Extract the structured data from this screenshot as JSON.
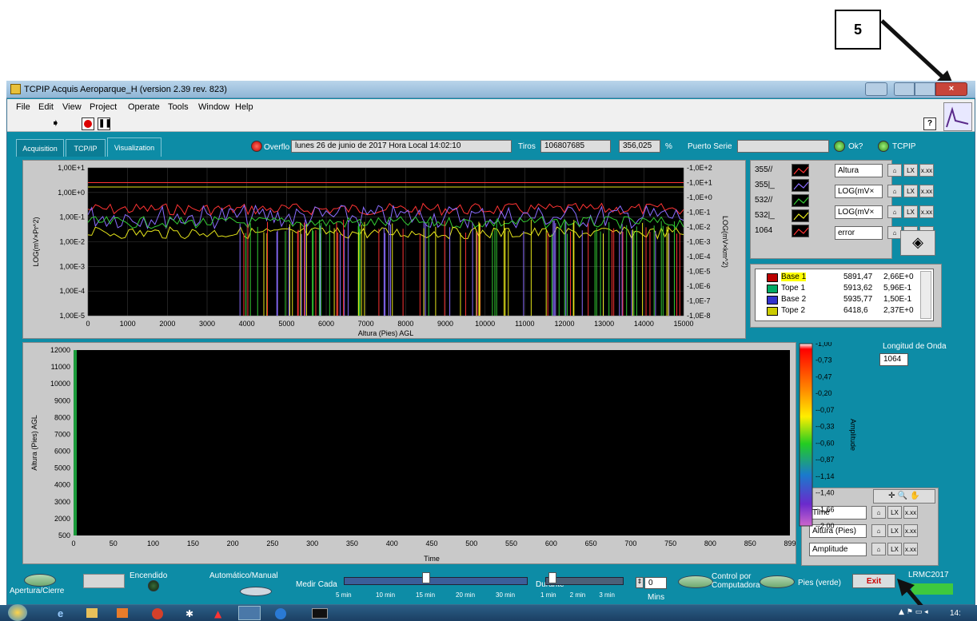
{
  "annotation": {
    "number": "5"
  },
  "window": {
    "title": "TCPIP Acquis Aeroparque_H (version 2.39 rev. 823)"
  },
  "menu": [
    "File",
    "Edit",
    "View",
    "Project",
    "Operate",
    "Tools",
    "Window",
    "Help"
  ],
  "tabs": [
    "Acquisition",
    "TCP/IP",
    "Visualization"
  ],
  "status": {
    "overflow": "Overflo",
    "datetime": "lunes 26 de junio de 2017  Hora Local  14:02:10",
    "tiros_label": "Tiros",
    "tiros_value": "106807685",
    "percent_value": "356,025",
    "percent_unit": "%",
    "puerto_label": "Puerto Serie",
    "puerto_value": "",
    "ok_label": "Ok?",
    "tcpip_label": "TCPIP"
  },
  "chart_data": [
    {
      "type": "line",
      "xlabel": "Altura (Pies)  AGL",
      "ylabel": "LOG(mV×Pr^2)",
      "ylabel_right": "LOG(mV×km^2)",
      "x_ticks": [
        "0",
        "1000",
        "2000",
        "3000",
        "4000",
        "5000",
        "6000",
        "7000",
        "8000",
        "9000",
        "10000",
        "11000",
        "12000",
        "13000",
        "14000",
        "15000"
      ],
      "y_ticks": [
        "1,00E+1",
        "1,00E+0",
        "1,00E-1",
        "1,00E-2",
        "1,00E-3",
        "1,00E-4",
        "1,00E-5"
      ],
      "y_ticks_right": [
        "-1,0E+2",
        "-1,0E+1",
        "-1,0E+0",
        "-1,0E-1",
        "-1,0E-2",
        "-1,0E-3",
        "-1,0E-4",
        "-1,0E-5",
        "-1,0E-6",
        "-1,0E-7",
        "-1,0E-8"
      ],
      "legend": [
        "355//",
        "355|_",
        "532//",
        "532|_",
        "1064"
      ],
      "legend_colors": [
        "#ff3333",
        "#8a6cff",
        "#33cc33",
        "#e6e61a",
        "#ff3333"
      ]
    },
    {
      "type": "heatmap",
      "xlabel": "Time",
      "ylabel": "Altura (Pies)  AGL",
      "x_ticks": [
        "0",
        "50",
        "100",
        "150",
        "200",
        "250",
        "300",
        "350",
        "400",
        "450",
        "500",
        "550",
        "600",
        "650",
        "700",
        "750",
        "800",
        "850",
        "899"
      ],
      "y_ticks": [
        "12000",
        "11000",
        "10000",
        "9000",
        "8000",
        "7000",
        "6000",
        "5000",
        "4000",
        "3000",
        "2000",
        "500"
      ],
      "colorbar_label": "Amplitude",
      "colorbar_ticks": [
        "-1,00",
        "-0,73",
        "-0,47",
        "-0,20",
        "--0,07",
        "--0,33",
        "--0,60",
        "--0,87",
        "--1,14",
        "--1,40",
        "--1,66",
        "--2,00"
      ]
    }
  ],
  "scales": {
    "rows": [
      "Altura",
      "LOG(mV×",
      "LOG(mV×",
      "error"
    ]
  },
  "cursor_table": {
    "rows": [
      {
        "name": "Base 1",
        "x": "5891,47",
        "y": "2,66E+0"
      },
      {
        "name": "Tope 1",
        "x": "5913,62",
        "y": "5,96E-1"
      },
      {
        "name": "Base 2",
        "x": "5935,77",
        "y": "1,50E-1"
      },
      {
        "name": "Tope 2",
        "x": "6418,6",
        "y": "2,37E+0"
      }
    ]
  },
  "wavelength": {
    "label": "Longitud de Onda",
    "value": "1064"
  },
  "scales2": {
    "rows": [
      "Time",
      "Altura (Pies)",
      "Amplitude"
    ]
  },
  "bottom": {
    "apertura": "Apertura/Cierre",
    "encendido": "Encendido",
    "auto": "Automático/Manual",
    "medir": "Medir Cada",
    "durante": "Durante",
    "medir_ticks": [
      "5 min",
      "10 min",
      "15 min",
      "20 min",
      "30 min"
    ],
    "durante_ticks": [
      "1 min",
      "2 min",
      "3 min"
    ],
    "mins": "Mins",
    "num_value": "0",
    "control": "Control por\nComputadora",
    "pies": "Pies (verde)",
    "exit": "Exit",
    "lrmc": "LRMC2017"
  },
  "taskbar": {
    "clock": "14:"
  }
}
